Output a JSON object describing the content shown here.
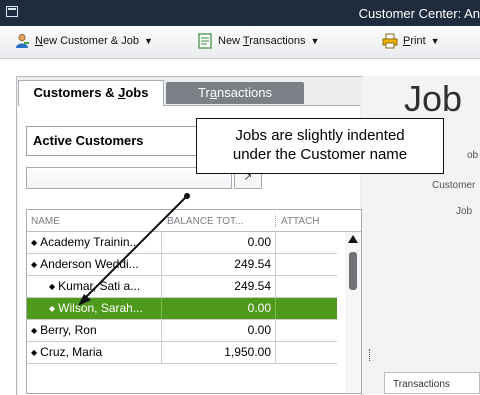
{
  "window": {
    "title": "Customer Center: An"
  },
  "toolbar": {
    "new_customer_job": {
      "prefix": "",
      "accel": "N",
      "rest": "ew Customer & Job"
    },
    "new_transactions": {
      "prefix": "New ",
      "accel": "T",
      "rest": "ransactions"
    },
    "print": {
      "prefix": "",
      "accel": "P",
      "rest": "rint"
    }
  },
  "tabs": {
    "customers_jobs": {
      "prefix": "Customers & ",
      "accel": "J",
      "rest": "obs"
    },
    "transactions": {
      "prefix": "Tr",
      "accel": "a",
      "rest": "nsactions"
    }
  },
  "filter": {
    "selected": "Active Customers"
  },
  "grid": {
    "headers": {
      "name": "NAME",
      "balance": "BALANCE TOT...",
      "attach": "ATTACH"
    },
    "rows": [
      {
        "name": "Academy Trainin...",
        "balance": "0.00"
      },
      {
        "name": "Anderson Weddi...",
        "balance": "249.54"
      },
      {
        "name": "Kumar, Sati a...",
        "balance": "249.54"
      },
      {
        "name": "Wilson, Sarah...",
        "balance": "0.00"
      },
      {
        "name": "Berry, Ron",
        "balance": "0.00"
      },
      {
        "name": "Cruz, Maria",
        "balance": "1,950.00"
      }
    ]
  },
  "right_panel": {
    "title": "Job",
    "label_1": "ob",
    "label_2": "Customer",
    "label_3": "Job",
    "bottom_tab": "Transactions"
  },
  "callout": {
    "line1": "Jobs are slightly indented",
    "line2": "under the Customer name"
  },
  "colors": {
    "selected_row": "#4f9a1d",
    "titlebar": "#1f2c3e"
  }
}
